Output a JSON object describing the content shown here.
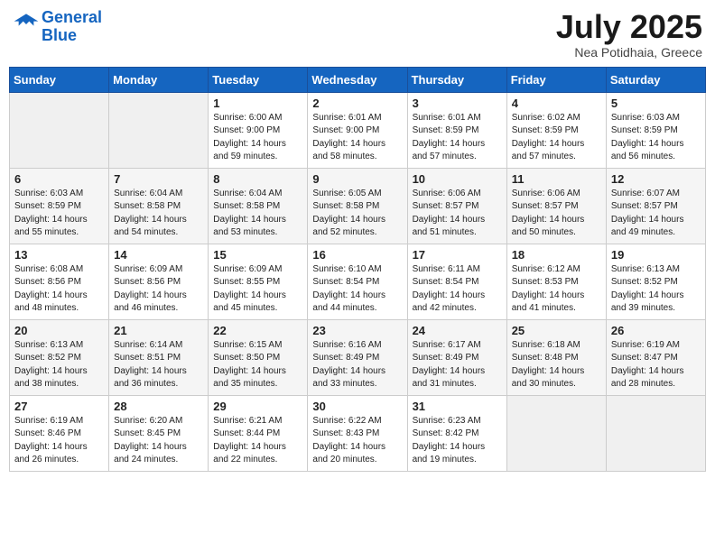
{
  "header": {
    "logo_line1": "General",
    "logo_line2": "Blue",
    "month": "July 2025",
    "location": "Nea Potidhaia, Greece"
  },
  "days_of_week": [
    "Sunday",
    "Monday",
    "Tuesday",
    "Wednesday",
    "Thursday",
    "Friday",
    "Saturday"
  ],
  "weeks": [
    [
      {
        "day": "",
        "info": ""
      },
      {
        "day": "",
        "info": ""
      },
      {
        "day": "1",
        "info": "Sunrise: 6:00 AM\nSunset: 9:00 PM\nDaylight: 14 hours\nand 59 minutes."
      },
      {
        "day": "2",
        "info": "Sunrise: 6:01 AM\nSunset: 9:00 PM\nDaylight: 14 hours\nand 58 minutes."
      },
      {
        "day": "3",
        "info": "Sunrise: 6:01 AM\nSunset: 8:59 PM\nDaylight: 14 hours\nand 57 minutes."
      },
      {
        "day": "4",
        "info": "Sunrise: 6:02 AM\nSunset: 8:59 PM\nDaylight: 14 hours\nand 57 minutes."
      },
      {
        "day": "5",
        "info": "Sunrise: 6:03 AM\nSunset: 8:59 PM\nDaylight: 14 hours\nand 56 minutes."
      }
    ],
    [
      {
        "day": "6",
        "info": "Sunrise: 6:03 AM\nSunset: 8:59 PM\nDaylight: 14 hours\nand 55 minutes."
      },
      {
        "day": "7",
        "info": "Sunrise: 6:04 AM\nSunset: 8:58 PM\nDaylight: 14 hours\nand 54 minutes."
      },
      {
        "day": "8",
        "info": "Sunrise: 6:04 AM\nSunset: 8:58 PM\nDaylight: 14 hours\nand 53 minutes."
      },
      {
        "day": "9",
        "info": "Sunrise: 6:05 AM\nSunset: 8:58 PM\nDaylight: 14 hours\nand 52 minutes."
      },
      {
        "day": "10",
        "info": "Sunrise: 6:06 AM\nSunset: 8:57 PM\nDaylight: 14 hours\nand 51 minutes."
      },
      {
        "day": "11",
        "info": "Sunrise: 6:06 AM\nSunset: 8:57 PM\nDaylight: 14 hours\nand 50 minutes."
      },
      {
        "day": "12",
        "info": "Sunrise: 6:07 AM\nSunset: 8:57 PM\nDaylight: 14 hours\nand 49 minutes."
      }
    ],
    [
      {
        "day": "13",
        "info": "Sunrise: 6:08 AM\nSunset: 8:56 PM\nDaylight: 14 hours\nand 48 minutes."
      },
      {
        "day": "14",
        "info": "Sunrise: 6:09 AM\nSunset: 8:56 PM\nDaylight: 14 hours\nand 46 minutes."
      },
      {
        "day": "15",
        "info": "Sunrise: 6:09 AM\nSunset: 8:55 PM\nDaylight: 14 hours\nand 45 minutes."
      },
      {
        "day": "16",
        "info": "Sunrise: 6:10 AM\nSunset: 8:54 PM\nDaylight: 14 hours\nand 44 minutes."
      },
      {
        "day": "17",
        "info": "Sunrise: 6:11 AM\nSunset: 8:54 PM\nDaylight: 14 hours\nand 42 minutes."
      },
      {
        "day": "18",
        "info": "Sunrise: 6:12 AM\nSunset: 8:53 PM\nDaylight: 14 hours\nand 41 minutes."
      },
      {
        "day": "19",
        "info": "Sunrise: 6:13 AM\nSunset: 8:52 PM\nDaylight: 14 hours\nand 39 minutes."
      }
    ],
    [
      {
        "day": "20",
        "info": "Sunrise: 6:13 AM\nSunset: 8:52 PM\nDaylight: 14 hours\nand 38 minutes."
      },
      {
        "day": "21",
        "info": "Sunrise: 6:14 AM\nSunset: 8:51 PM\nDaylight: 14 hours\nand 36 minutes."
      },
      {
        "day": "22",
        "info": "Sunrise: 6:15 AM\nSunset: 8:50 PM\nDaylight: 14 hours\nand 35 minutes."
      },
      {
        "day": "23",
        "info": "Sunrise: 6:16 AM\nSunset: 8:49 PM\nDaylight: 14 hours\nand 33 minutes."
      },
      {
        "day": "24",
        "info": "Sunrise: 6:17 AM\nSunset: 8:49 PM\nDaylight: 14 hours\nand 31 minutes."
      },
      {
        "day": "25",
        "info": "Sunrise: 6:18 AM\nSunset: 8:48 PM\nDaylight: 14 hours\nand 30 minutes."
      },
      {
        "day": "26",
        "info": "Sunrise: 6:19 AM\nSunset: 8:47 PM\nDaylight: 14 hours\nand 28 minutes."
      }
    ],
    [
      {
        "day": "27",
        "info": "Sunrise: 6:19 AM\nSunset: 8:46 PM\nDaylight: 14 hours\nand 26 minutes."
      },
      {
        "day": "28",
        "info": "Sunrise: 6:20 AM\nSunset: 8:45 PM\nDaylight: 14 hours\nand 24 minutes."
      },
      {
        "day": "29",
        "info": "Sunrise: 6:21 AM\nSunset: 8:44 PM\nDaylight: 14 hours\nand 22 minutes."
      },
      {
        "day": "30",
        "info": "Sunrise: 6:22 AM\nSunset: 8:43 PM\nDaylight: 14 hours\nand 20 minutes."
      },
      {
        "day": "31",
        "info": "Sunrise: 6:23 AM\nSunset: 8:42 PM\nDaylight: 14 hours\nand 19 minutes."
      },
      {
        "day": "",
        "info": ""
      },
      {
        "day": "",
        "info": ""
      }
    ]
  ]
}
